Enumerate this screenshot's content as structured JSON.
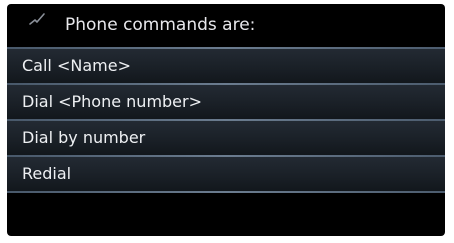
{
  "header": {
    "icon": "voice-command-icon",
    "title": "Phone commands are:"
  },
  "commands": [
    {
      "label": "Call <Name>"
    },
    {
      "label": "Dial <Phone number>"
    },
    {
      "label": "Dial by number"
    },
    {
      "label": "Redial"
    }
  ],
  "colors": {
    "background": "#000000",
    "text": "#eef0f3",
    "divider": "#6b7c8f",
    "row": "#1a2027"
  }
}
